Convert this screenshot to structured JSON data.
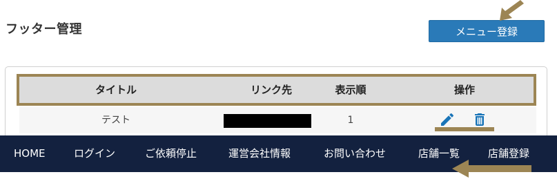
{
  "page": {
    "title": "フッター管理"
  },
  "toolbar": {
    "menu_register_label": "メニュー登録"
  },
  "table": {
    "headers": [
      "タイトル",
      "リンク先",
      "表示順",
      "操作"
    ],
    "rows": [
      {
        "title": "テスト",
        "link": "",
        "order": "1"
      }
    ]
  },
  "icons": {
    "edit": "pencil-icon",
    "delete": "trash-icon",
    "annotation": "arrow-icon"
  },
  "footer": {
    "links": [
      "HOME",
      "ログイン",
      "ご依頼停止",
      "運営会社情報",
      "お問い合わせ",
      "店舗一覧",
      "店舗登録"
    ]
  },
  "colors": {
    "primary_button": "#2a7ab8",
    "icon_blue": "#1a75b8",
    "annotation_gold": "#9c8554",
    "footer_bg": "#13213f",
    "header_bg": "#dcdcdc"
  }
}
